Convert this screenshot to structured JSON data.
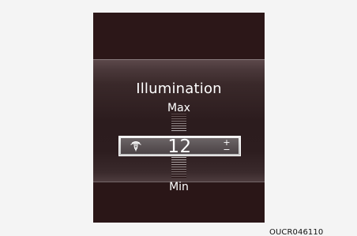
{
  "screen": {
    "title": "Illumination",
    "max_label": "Max",
    "min_label": "Min",
    "value": "12",
    "increment_symbol": "+",
    "decrement_symbol": "−",
    "icon": "illumination-dimmer-icon"
  },
  "caption": "OUCR046110",
  "colors": {
    "page_background": "#f4f4f4",
    "display_background": "#2b1718",
    "panel_highlight": "#5d4a4c",
    "text": "#ffffff",
    "value_bar": "#5b5355",
    "caption": "#111111"
  }
}
